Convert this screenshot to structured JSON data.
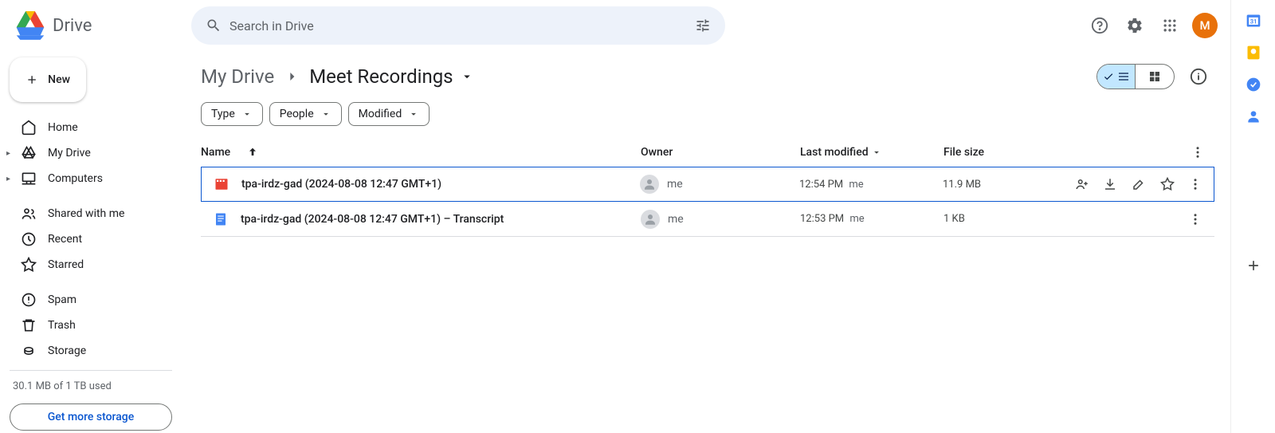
{
  "app": {
    "name": "Drive",
    "search_placeholder": "Search in Drive",
    "avatar_letter": "M"
  },
  "sidebar": {
    "new_label": "New",
    "items": [
      {
        "label": "Home",
        "icon": "home"
      },
      {
        "label": "My Drive",
        "icon": "drive",
        "expandable": true
      },
      {
        "label": "Computers",
        "icon": "computers",
        "expandable": true
      }
    ],
    "shared_items": [
      {
        "label": "Shared with me",
        "icon": "shared"
      },
      {
        "label": "Recent",
        "icon": "recent"
      },
      {
        "label": "Starred",
        "icon": "star"
      }
    ],
    "bottom_items": [
      {
        "label": "Spam",
        "icon": "spam"
      },
      {
        "label": "Trash",
        "icon": "trash"
      },
      {
        "label": "Storage",
        "icon": "storage"
      }
    ],
    "storage_text": "30.1 MB of 1 TB used",
    "storage_btn": "Get more storage"
  },
  "breadcrumb": {
    "parent": "My Drive",
    "current": "Meet Recordings"
  },
  "filters": {
    "type": "Type",
    "people": "People",
    "modified": "Modified"
  },
  "columns": {
    "name": "Name",
    "owner": "Owner",
    "modified": "Last modified",
    "size": "File size"
  },
  "rows": [
    {
      "icon": "video",
      "name": "tpa-irdz-gad (2024-08-08 12:47 GMT+1)",
      "owner": "me",
      "modified_time": "12:54 PM",
      "modified_by": "me",
      "size": "11.9 MB",
      "selected": true
    },
    {
      "icon": "doc",
      "name": "tpa-irdz-gad (2024-08-08 12:47 GMT+1) – Transcript",
      "owner": "me",
      "modified_time": "12:53 PM",
      "modified_by": "me",
      "size": "1 KB",
      "selected": false
    }
  ]
}
